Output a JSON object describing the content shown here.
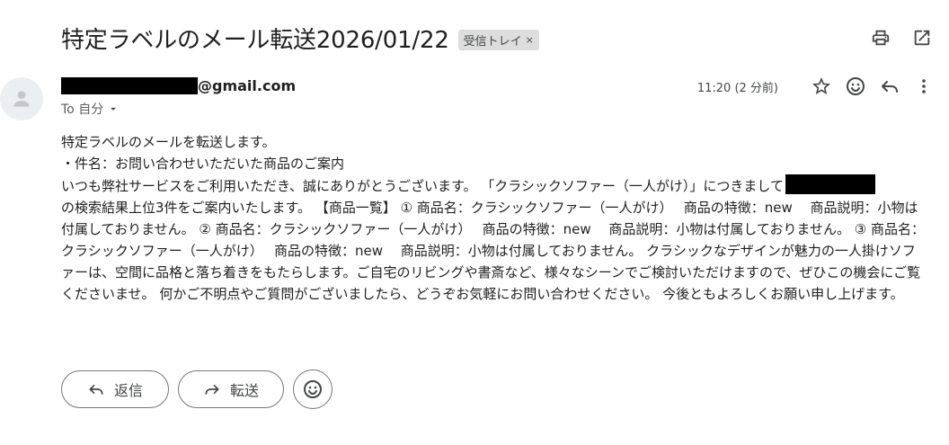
{
  "subject": {
    "title": "特定ラベルのメール転送2026/01/22",
    "label_chip": "受信トレイ",
    "label_remove": "×"
  },
  "top_actions": {
    "print_icon": "print-icon",
    "open_new_window_icon": "open-in-new-window-icon"
  },
  "sender": {
    "email_suffix": "@gmail.com",
    "to_label": "To 自分"
  },
  "meta": {
    "time": "11:20 (2 分前)",
    "icons": [
      "star-icon",
      "emoji-icon",
      "reply-icon",
      "more-vert-icon"
    ]
  },
  "body": {
    "line1": "特定ラベルのメールを転送します。",
    "line2": "・件名：お問い合わせいただいた商品のご案内",
    "line3": "いつも弊社サービスをご利用いただき、誠にありがとうございます。 「クラシックソファー（一人がけ）」につきまして",
    "paragraph": "の検索結果上位3件をご案内いたします。 【商品一覧】 ① 商品名：クラシックソファー（一人がけ）　 商品の特徴：new　 商品説明：小物は付属しておりません。 ② 商品名：クラシックソファー（一人がけ）　 商品の特徴：new　 商品説明：小物は付属しておりません。 ③ 商品名：クラシックソファー（一人がけ）　 商品の特徴：new　 商品説明：小物は付属しておりません。 クラシックなデザインが魅力の一人掛けソファーは、空間に品格と落ち着きをもたらします。ご自宅のリビングや書斎など、様々なシーンでご検討いただけますので、ぜひこの機会にご覧くださいませ。 何かご不明点やご質問がございましたら、どうぞお気軽にお問い合わせください。 今後ともよろしくお願い申し上げます。"
  },
  "actions": {
    "reply_label": "返信",
    "forward_label": "転送"
  },
  "colors": {
    "icon": "#444746",
    "chip_bg": "#dddddd",
    "border": "#747775"
  }
}
